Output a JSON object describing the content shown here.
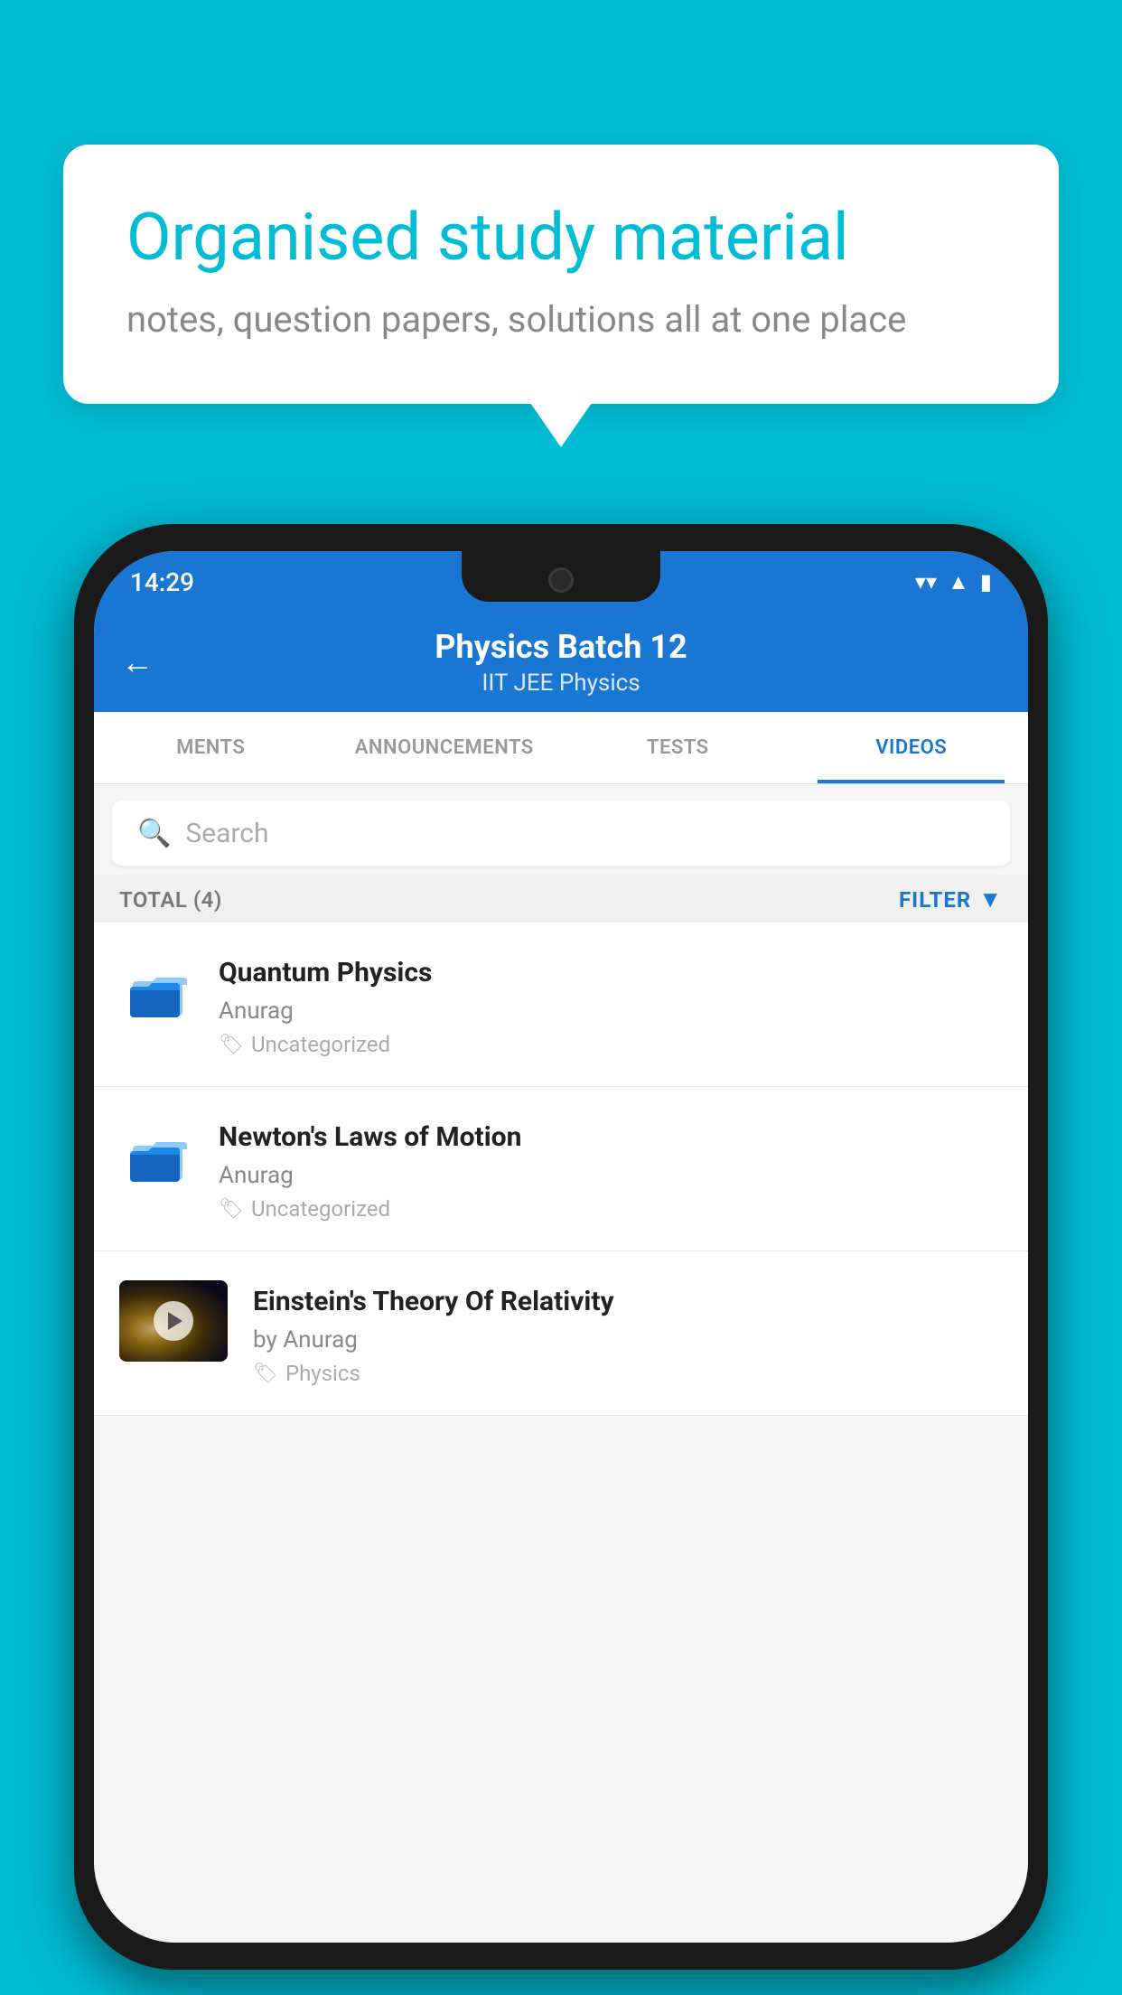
{
  "background_color": "#00bcd4",
  "bubble": {
    "title": "Organised study material",
    "subtitle": "notes, question papers, solutions all at one place"
  },
  "phone": {
    "status_bar": {
      "time": "14:29",
      "icons": [
        "wifi",
        "signal",
        "battery"
      ]
    },
    "header": {
      "title": "Physics Batch 12",
      "subtitle": "IIT JEE   Physics",
      "back_label": "←"
    },
    "tabs": [
      {
        "label": "MENTS",
        "active": false
      },
      {
        "label": "ANNOUNCEMENTS",
        "active": false
      },
      {
        "label": "TESTS",
        "active": false
      },
      {
        "label": "VIDEOS",
        "active": true
      }
    ],
    "search": {
      "placeholder": "Search"
    },
    "filter_row": {
      "total": "TOTAL (4)",
      "filter_label": "FILTER"
    },
    "videos": [
      {
        "id": "1",
        "title": "Quantum Physics",
        "author": "Anurag",
        "tag": "Uncategorized",
        "has_thumb": false
      },
      {
        "id": "2",
        "title": "Newton's Laws of Motion",
        "author": "Anurag",
        "tag": "Uncategorized",
        "has_thumb": false
      },
      {
        "id": "3",
        "title": "Einstein's Theory Of Relativity",
        "author": "by Anurag",
        "tag": "Physics",
        "has_thumb": true
      }
    ]
  }
}
